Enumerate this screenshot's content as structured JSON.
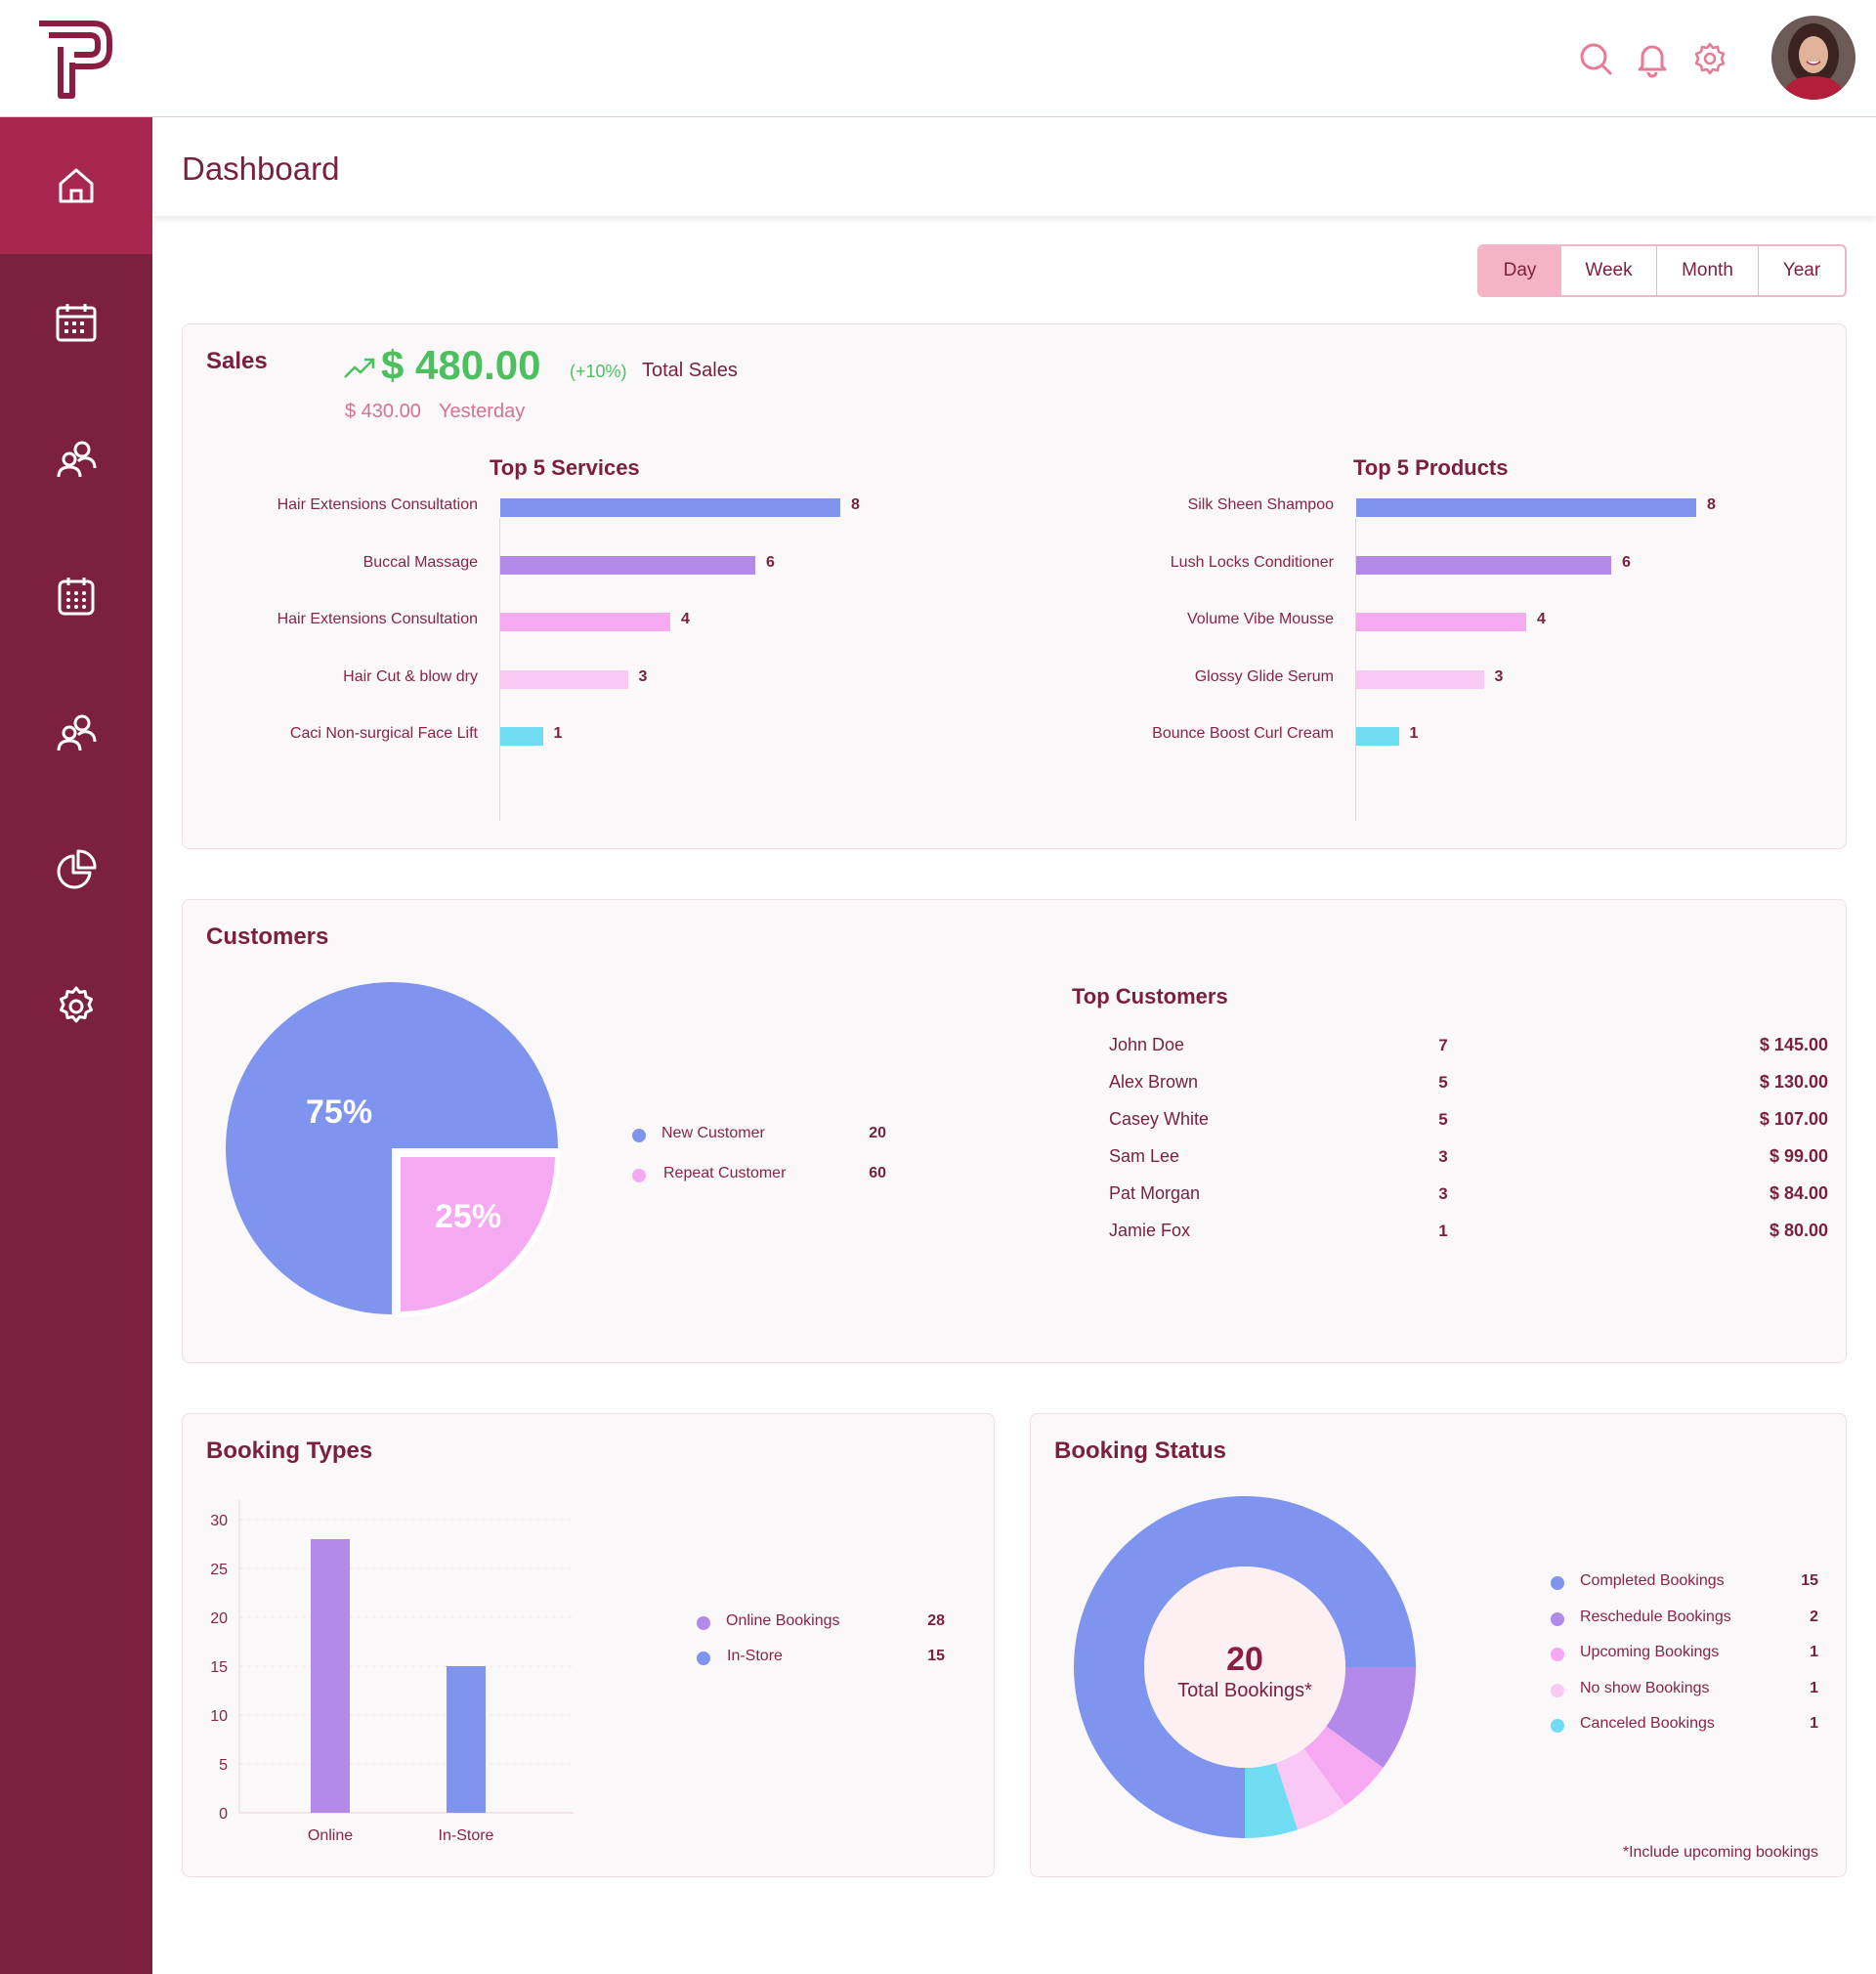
{
  "header": {
    "icons": [
      "search-icon",
      "bell-icon",
      "gear-icon"
    ],
    "avatar": "user-avatar"
  },
  "sidebar": {
    "items": [
      {
        "name": "home",
        "icon": "home-icon",
        "active": true
      },
      {
        "name": "calendar",
        "icon": "calendar-icon"
      },
      {
        "name": "customers",
        "icon": "users-icon"
      },
      {
        "name": "bookings",
        "icon": "calendar-grid-icon"
      },
      {
        "name": "staff",
        "icon": "users-icon"
      },
      {
        "name": "reports",
        "icon": "pie-chart-icon"
      },
      {
        "name": "settings",
        "icon": "gear-icon"
      }
    ]
  },
  "page": {
    "title": "Dashboard"
  },
  "range_tabs": [
    "Day",
    "Week",
    "Month",
    "Year"
  ],
  "range_selected": "Day",
  "sales": {
    "title": "Sales",
    "total": "$ 480.00",
    "change": "(+10%)",
    "total_label": "Total Sales",
    "yesterday_value": "$ 430.00",
    "yesterday_label": "Yesterday"
  },
  "colors": {
    "primary": "#7b213f",
    "active": "#a8274f",
    "blue": "#7f94ef",
    "purple": "#b38ae9",
    "pink": "#f5a9f0",
    "lightpink": "#f9c8f5",
    "cyan": "#6fdcf1",
    "green": "#4cbf5f"
  },
  "chart_data": [
    {
      "type": "bar",
      "orientation": "horizontal",
      "title": "Top 5 Services",
      "categories": [
        "Hair Extensions Consultation",
        "Buccal Massage",
        "Hair Extensions Consultation",
        "Hair Cut & blow dry",
        "Caci Non-surgical Face Lift"
      ],
      "values": [
        8,
        6,
        4,
        3,
        1
      ],
      "colors": [
        "#7f94ef",
        "#b38ae9",
        "#f5a9f0",
        "#f9c8f5",
        "#6fdcf1"
      ]
    },
    {
      "type": "bar",
      "orientation": "horizontal",
      "title": "Top 5 Products",
      "categories": [
        "Silk Sheen Shampoo",
        "Lush Locks Conditioner",
        "Volume Vibe Mousse",
        "Glossy Glide Serum",
        "Bounce Boost Curl Cream"
      ],
      "values": [
        8,
        6,
        4,
        3,
        1
      ],
      "colors": [
        "#7f94ef",
        "#b38ae9",
        "#f5a9f0",
        "#f9c8f5",
        "#6fdcf1"
      ]
    },
    {
      "type": "pie",
      "title": "Customers",
      "slices": [
        {
          "label": "New Customer",
          "percent": 75,
          "value": 20,
          "color": "#7f94ef",
          "display": "75%"
        },
        {
          "label": "Repeat Customer",
          "percent": 25,
          "value": 60,
          "color": "#f5a9f0",
          "display": "25%"
        }
      ]
    },
    {
      "type": "bar",
      "title": "Booking Types",
      "categories": [
        "Online",
        "In-Store"
      ],
      "values": [
        28,
        15
      ],
      "colors": [
        "#b38ae9",
        "#7f94ef"
      ],
      "yticks": [
        0,
        5,
        10,
        15,
        20,
        25,
        30
      ],
      "ylim": [
        0,
        30
      ],
      "legend": [
        {
          "label": "Online Bookings",
          "value": 28,
          "color": "#b38ae9"
        },
        {
          "label": "In-Store",
          "value": 15,
          "color": "#7f94ef"
        }
      ]
    },
    {
      "type": "pie",
      "subtype": "donut",
      "title": "Booking Status",
      "center_value": "20",
      "center_label": "Total Bookings*",
      "footnote": "*Include upcoming bookings",
      "slices": [
        {
          "label": "Completed Bookings",
          "value": 15,
          "color": "#7f94ef"
        },
        {
          "label": "Reschedule Bookings",
          "value": 2,
          "color": "#b38ae9"
        },
        {
          "label": "Upcoming Bookings",
          "value": 1,
          "color": "#f5a9f0"
        },
        {
          "label": "No show Bookings",
          "value": 1,
          "color": "#f9c8f5"
        },
        {
          "label": "Canceled Bookings",
          "value": 1,
          "color": "#6fdcf1"
        }
      ]
    }
  ],
  "top_customers": {
    "title": "Top Customers",
    "rows": [
      {
        "name": "John Doe",
        "count": "7",
        "amount": "$ 145.00"
      },
      {
        "name": "Alex Brown",
        "count": "5",
        "amount": "$ 130.00"
      },
      {
        "name": "Casey White",
        "count": "5",
        "amount": "$ 107.00"
      },
      {
        "name": "Sam Lee",
        "count": "3",
        "amount": "$ 99.00"
      },
      {
        "name": "Pat Morgan",
        "count": "3",
        "amount": "$ 84.00"
      },
      {
        "name": "Jamie Fox",
        "count": "1",
        "amount": "$ 80.00"
      }
    ]
  }
}
